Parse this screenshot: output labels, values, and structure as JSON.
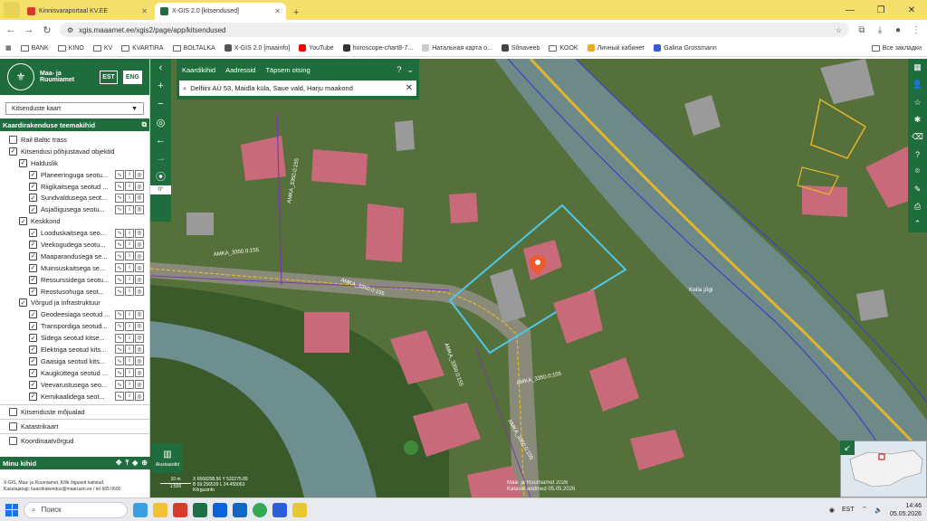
{
  "browser": {
    "tabs": [
      {
        "label": "Kinnisvaraportaal KV.EE",
        "color": "#d63b2b"
      },
      {
        "label": "X-GIS 2.0 [kitsendused]",
        "color": "#1f6c3c"
      }
    ],
    "url": "xgis.maaamet.ee/xgis2/page/app/kitsendused",
    "bookmarks": [
      {
        "label": "BANK",
        "type": "folder"
      },
      {
        "label": "KINO",
        "type": "folder"
      },
      {
        "label": "KV",
        "type": "folder"
      },
      {
        "label": "KVARTIRA",
        "type": "folder"
      },
      {
        "label": "BOLTALKA",
        "type": "folder"
      },
      {
        "label": "X-GIS 2.0 [maainfo]",
        "type": "site",
        "color": "#555555"
      },
      {
        "label": "YouTube",
        "type": "site",
        "color": "#ff0000"
      },
      {
        "label": "horoscope-chart8-7...",
        "type": "site",
        "color": "#333333"
      },
      {
        "label": "Натальная карта о...",
        "type": "site",
        "color": "#cccccc"
      },
      {
        "label": "Sõnaveeb",
        "type": "site",
        "color": "#444444"
      },
      {
        "label": "KOOK",
        "type": "folder"
      },
      {
        "label": "Личный кабинет",
        "type": "site",
        "color": "#f5a623"
      },
      {
        "label": "Galina Grossmann",
        "type": "site",
        "color": "#3b5bdb"
      }
    ],
    "other_bookmarks": "Все закладки"
  },
  "app": {
    "brand": "Maa- ja Ruumiamet",
    "lang_est": "EST",
    "lang_eng": "ENG",
    "map_select": "Kitsenduste kaart",
    "layers_header": "Kaardirakenduse teemakihid",
    "layers": [
      {
        "label": "Rail Baltic trass",
        "level": 0,
        "checked": false,
        "tools": false
      },
      {
        "label": "Kitsendusi põhjustavad objektid",
        "level": 0,
        "checked": true,
        "tools": false
      },
      {
        "label": "Halduslik",
        "level": 1,
        "checked": true,
        "tools": false
      },
      {
        "label": "Planeeringuga seotu...",
        "level": 2,
        "checked": true,
        "tools": true
      },
      {
        "label": "Riigikaitsega seotud ...",
        "level": 2,
        "checked": true,
        "tools": true
      },
      {
        "label": "Sundvaldusega seot...",
        "level": 2,
        "checked": true,
        "tools": true
      },
      {
        "label": "Asjaõigusega seotu...",
        "level": 2,
        "checked": true,
        "tools": true
      },
      {
        "label": "Keskkond",
        "level": 1,
        "checked": true,
        "tools": false
      },
      {
        "label": "Looduskaitsega seo...",
        "level": 2,
        "checked": true,
        "tools": true
      },
      {
        "label": "Veekogudega seotu...",
        "level": 2,
        "checked": true,
        "tools": true
      },
      {
        "label": "Maaparandusega se...",
        "level": 2,
        "checked": true,
        "tools": true
      },
      {
        "label": "Muinsuskaitsega se...",
        "level": 2,
        "checked": true,
        "tools": true
      },
      {
        "label": "Ressurssidega seotu...",
        "level": 2,
        "checked": true,
        "tools": true
      },
      {
        "label": "Reostusohuga seot...",
        "level": 2,
        "checked": true,
        "tools": true
      },
      {
        "label": "Võrgud ja infrastruktuur",
        "level": 1,
        "checked": true,
        "tools": false
      },
      {
        "label": "Geodeesiaga seotud ...",
        "level": 2,
        "checked": true,
        "tools": true
      },
      {
        "label": "Transpordiga seotud...",
        "level": 2,
        "checked": true,
        "tools": true
      },
      {
        "label": "Sidega seotud kitse...",
        "level": 2,
        "checked": true,
        "tools": true
      },
      {
        "label": "Elektriga seotud kits...",
        "level": 2,
        "checked": true,
        "tools": true
      },
      {
        "label": "Gaasiga seotud kits...",
        "level": 2,
        "checked": true,
        "tools": true
      },
      {
        "label": "Kaugküttega seotud ...",
        "level": 2,
        "checked": true,
        "tools": true
      },
      {
        "label": "Veevarustusega seo...",
        "level": 2,
        "checked": true,
        "tools": true
      },
      {
        "label": "Kemikaalidega seot...",
        "level": 2,
        "checked": true,
        "tools": true
      },
      {
        "label": "Kitsenduste mõjualad",
        "level": 0,
        "checked": false,
        "tools": false,
        "sep": true
      },
      {
        "label": "Katastrikaart",
        "level": 0,
        "checked": false,
        "tools": false,
        "sep": true
      },
      {
        "label": "Koordinaatvõrgud",
        "level": 0,
        "checked": false,
        "tools": false,
        "sep": true
      }
    ],
    "my_layers": "Minu kihid",
    "footer_line1": "X-GIS, Maa- ja Ruumiamet. Kõik õigused kaitstud.",
    "footer_line2": "Kasutajatugi: kaardirakendus@maaruum.ee / tel 665 0600",
    "search_tabs": [
      "Kaardikihid",
      "Aadressid",
      "Täpsem otsing"
    ],
    "search_value": "Delfiini AÜ 53, Maidla küla, Saue vald, Harju maakond",
    "rotation": "0°",
    "basemaps": "Aluskaardid",
    "scale_label": "10 m",
    "scale_ratio": "1:500",
    "coords_line1": "X 6568208.56 Y 532275.89",
    "coords_line2": "B 59.256539 L 24.455063",
    "coords_line3": "Kõrgusinfo",
    "credit_line1": "Maa- ja Ruumiamet 2026",
    "credit_line2": "Katastri andmed 05.05.2026",
    "map_labels": {
      "road1": "AMKA_3350.0:155",
      "road2": "AMKA_3350.0:155",
      "road3": "AMKA_3350.0:155",
      "road4": "AMKA_3350.0:155",
      "road5": "AMKA_3350.0:155",
      "river": "Keila jõgi",
      "lbl_a": "AMKA_3350.0:155"
    }
  },
  "taskbar": {
    "search": "Поиск",
    "lang": "EST",
    "time": "14:46",
    "date": "05.05.2026"
  }
}
